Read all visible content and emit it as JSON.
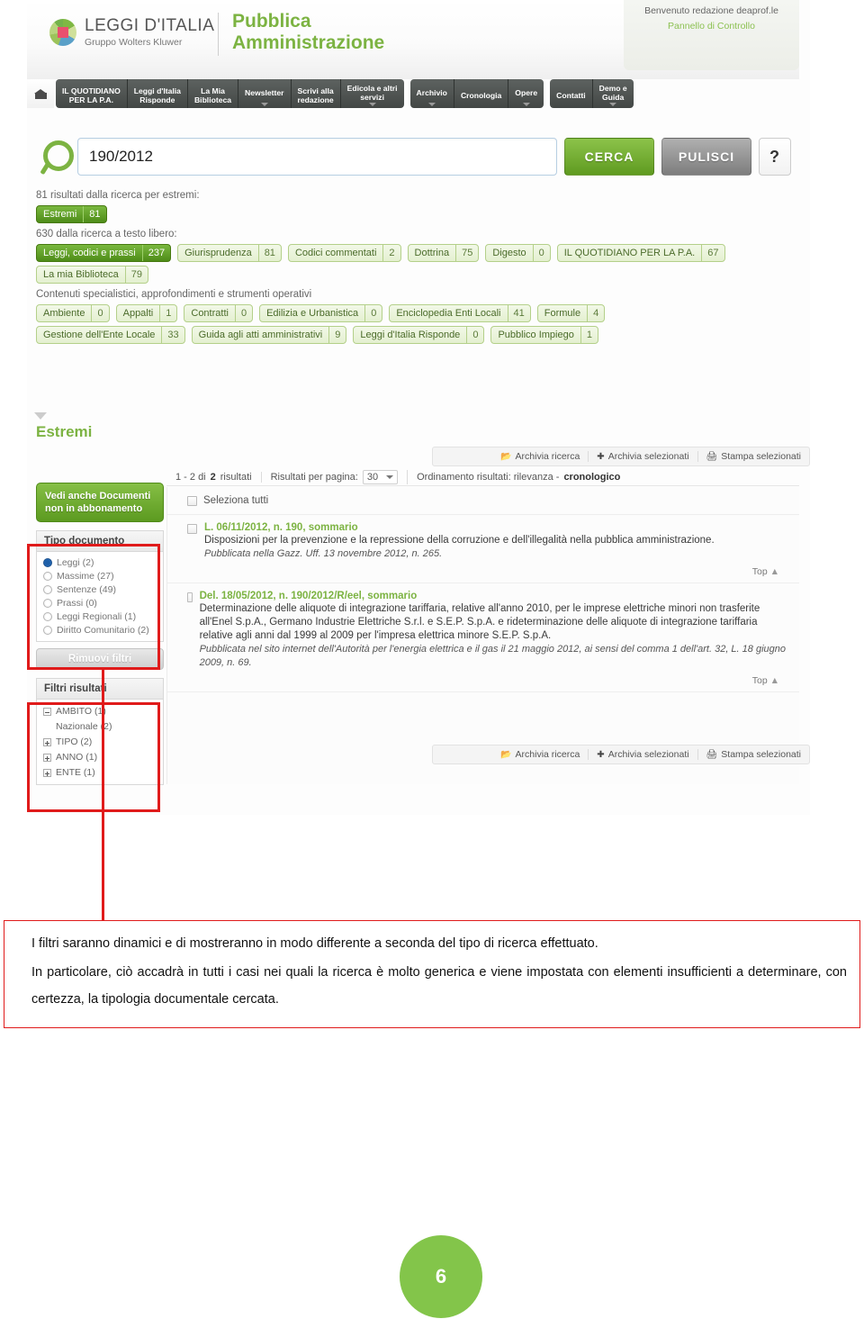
{
  "header": {
    "logo_title": "LEGGI D'ITALIA",
    "logo_subtitle": "Gruppo Wolters Kluwer",
    "brand_line1": "Pubblica",
    "brand_line2": "Amministrazione",
    "welcome": "Benvenuto redazione deaprof.le",
    "control_panel": "Pannello di Controllo"
  },
  "nav": {
    "group1": [
      {
        "l1": "IL QUOTIDIANO",
        "l2": "PER LA P.A.",
        "caret": false
      },
      {
        "l1": "Leggi d'Italia",
        "l2": "Risponde",
        "caret": false
      },
      {
        "l1": "La Mia",
        "l2": "Biblioteca",
        "caret": false
      },
      {
        "l1": "Newsletter",
        "l2": "",
        "caret": true
      },
      {
        "l1": "Scrivi alla",
        "l2": "redazione",
        "caret": false
      },
      {
        "l1": "Edicola e altri",
        "l2": "servizi",
        "caret": true
      }
    ],
    "group2": [
      {
        "l1": "Archivio",
        "l2": "",
        "caret": true
      },
      {
        "l1": "Cronologia",
        "l2": "",
        "caret": false
      },
      {
        "l1": "Opere",
        "l2": "",
        "caret": true
      }
    ],
    "group3": [
      {
        "l1": "Contatti",
        "l2": "",
        "caret": false
      },
      {
        "l1": "Demo e",
        "l2": "Guida",
        "caret": true
      }
    ]
  },
  "search": {
    "value": "190/2012",
    "placeholder": "",
    "cerca": "CERCA",
    "pulisci": "PULISCI",
    "help": "?"
  },
  "facets": {
    "lead_estremi": "81 risultati dalla ricerca per estremi:",
    "estremi_chip": {
      "label": "Estremi",
      "count": "81"
    },
    "lead_libero": "630 dalla ricerca a testo libero:",
    "row1": [
      {
        "label": "Leggi, codici e prassi",
        "count": "237",
        "selected": true
      },
      {
        "label": "Giurisprudenza",
        "count": "81",
        "selected": false
      },
      {
        "label": "Codici commentati",
        "count": "2",
        "selected": false
      },
      {
        "label": "Dottrina",
        "count": "75",
        "selected": false
      },
      {
        "label": "Digesto",
        "count": "0",
        "selected": false
      },
      {
        "label": "IL QUOTIDIANO PER LA P.A.",
        "count": "67",
        "selected": false
      }
    ],
    "row2": [
      {
        "label": "La mia Biblioteca",
        "count": "79",
        "selected": false
      }
    ],
    "lead_speciali": "Contenuti specialistici, approfondimenti e strumenti operativi",
    "row3": [
      {
        "label": "Ambiente",
        "count": "0",
        "selected": false
      },
      {
        "label": "Appalti",
        "count": "1",
        "selected": false
      },
      {
        "label": "Contratti",
        "count": "0",
        "selected": false
      },
      {
        "label": "Edilizia e Urbanistica",
        "count": "0",
        "selected": false
      },
      {
        "label": "Enciclopedia Enti Locali",
        "count": "41",
        "selected": false
      },
      {
        "label": "Formule",
        "count": "4",
        "selected": false
      }
    ],
    "row4": [
      {
        "label": "Gestione dell'Ente Locale",
        "count": "33",
        "selected": false
      },
      {
        "label": "Guida agli atti amministrativi",
        "count": "9",
        "selected": false
      },
      {
        "label": "Leggi d'Italia Risponde",
        "count": "0",
        "selected": false
      },
      {
        "label": "Pubblico Impiego",
        "count": "1",
        "selected": false
      }
    ]
  },
  "results": {
    "section_title": "Estremi",
    "toolbar": [
      {
        "icon": "archive-search-icon",
        "label": "Archivia ricerca"
      },
      {
        "icon": "archive-selected-icon",
        "label": "Archivia selezionati"
      },
      {
        "icon": "print-icon",
        "label": "Stampa selezionati"
      }
    ],
    "count_prefix": "1 - 2 di ",
    "count_bold": "2",
    "count_suffix": " risultati",
    "per_page_label": "Risultati per pagina:",
    "per_page_value": "30",
    "sort_label": "Ordinamento risultati: rilevanza - ",
    "sort_value": "cronologico",
    "select_all": "Seleziona tutti",
    "top_label": "Top",
    "items": [
      {
        "title": "L. 06/11/2012, n. 190, sommario",
        "body": "Disposizioni per la prevenzione e la repressione della corruzione e dell'illegalità nella pubblica amministrazione.",
        "source": "Pubblicata nella Gazz. Uff. 13 novembre 2012, n. 265."
      },
      {
        "title": "Del. 18/05/2012, n. 190/2012/R/eel, sommario",
        "body": "Determinazione delle aliquote di integrazione tariffaria, relative all'anno 2010, per le imprese elettriche minori non trasferite all'Enel S.p.A., Germano Industrie Elettriche S.r.l. e S.E.P. S.p.A. e rideterminazione delle aliquote di integrazione tariffaria relative agli anni dal 1999 al 2009 per l'impresa elettrica minore S.E.P. S.p.A.",
        "source": "Pubblicata nel sito internet dell'Autorità per l'energia elettrica e il gas il 21 maggio 2012, ai sensi del comma 1 dell'art. 32, L. 18 giugno 2009, n. 69."
      }
    ]
  },
  "sidebar": {
    "vedi_anche": "Vedi anche Documenti non in abbonamento",
    "tipo_documento_title": "Tipo documento",
    "tipo_documento_options": [
      {
        "label": "Leggi (2)",
        "selected": true
      },
      {
        "label": "Massime (27)",
        "selected": false
      },
      {
        "label": "Sentenze (49)",
        "selected": false
      },
      {
        "label": "Prassi (0)",
        "selected": false
      },
      {
        "label": "Leggi Regionali (1)",
        "selected": false
      },
      {
        "label": "Diritto Comunitario (2)",
        "selected": false
      }
    ],
    "rimuovi_filtri": "Rimuovi filtri",
    "filtri_risultati_title": "Filtri risultati",
    "filtri": [
      {
        "label": "AMBITO (1)",
        "expanded": true,
        "child": "Nazionale (2)"
      },
      {
        "label": "TIPO (2)",
        "expanded": false,
        "child": null
      },
      {
        "label": "ANNO (1)",
        "expanded": false,
        "child": null
      },
      {
        "label": "ENTE (1)",
        "expanded": false,
        "child": null
      }
    ]
  },
  "caption": {
    "line1": "I filtri saranno dinamici e di mostreranno in modo differente a seconda del tipo di ricerca effettuato.",
    "line2": "In particolare, ciò accadrà in tutti i casi nei quali la ricerca è molto generica e viene impostata con elementi insufficienti a determinare, con certezza, la tipologia documentale cercata."
  },
  "page_number": "6",
  "colors": {
    "brand_green": "#7cb342",
    "annotation_red": "#e01b1b",
    "nav_dark": "#4a4f4d",
    "page_badge": "#83c54a"
  }
}
